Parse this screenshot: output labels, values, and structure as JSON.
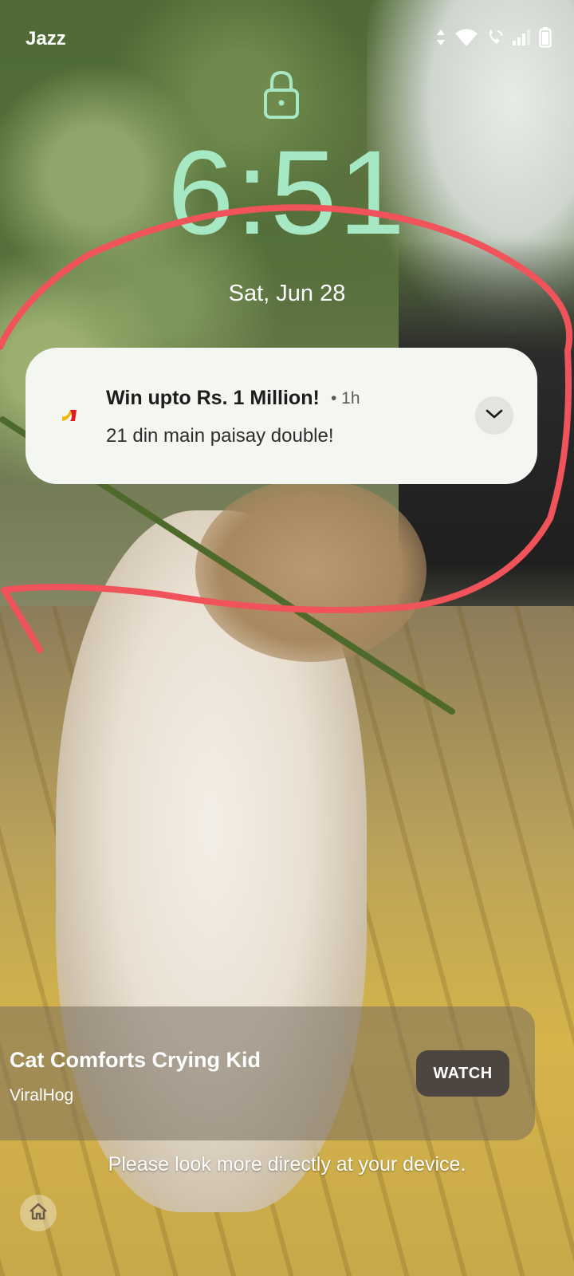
{
  "status_bar": {
    "carrier": "Jazz",
    "icons": [
      "data-arrows-icon",
      "wifi-icon",
      "wifi-calling-icon",
      "signal-icon",
      "battery-icon"
    ]
  },
  "lockscreen": {
    "lock_icon": "lock-icon",
    "time": "6:51",
    "date": "Sat, Jun 28",
    "clock_color": "#a6e8c3"
  },
  "notification": {
    "app_icon": "app-logo-icon",
    "title": "Win upto Rs. 1 Million!",
    "meta": "• 1h",
    "body": "21 din main paisay double!",
    "expand_icon": "chevron-down-icon"
  },
  "media_card": {
    "title": "Cat Comforts Crying Kid",
    "source": "ViralHog",
    "action_label": "WATCH"
  },
  "hint": "Please look more directly at your device.",
  "home_icon": "home-icon",
  "annotation_color": "#f0535a"
}
